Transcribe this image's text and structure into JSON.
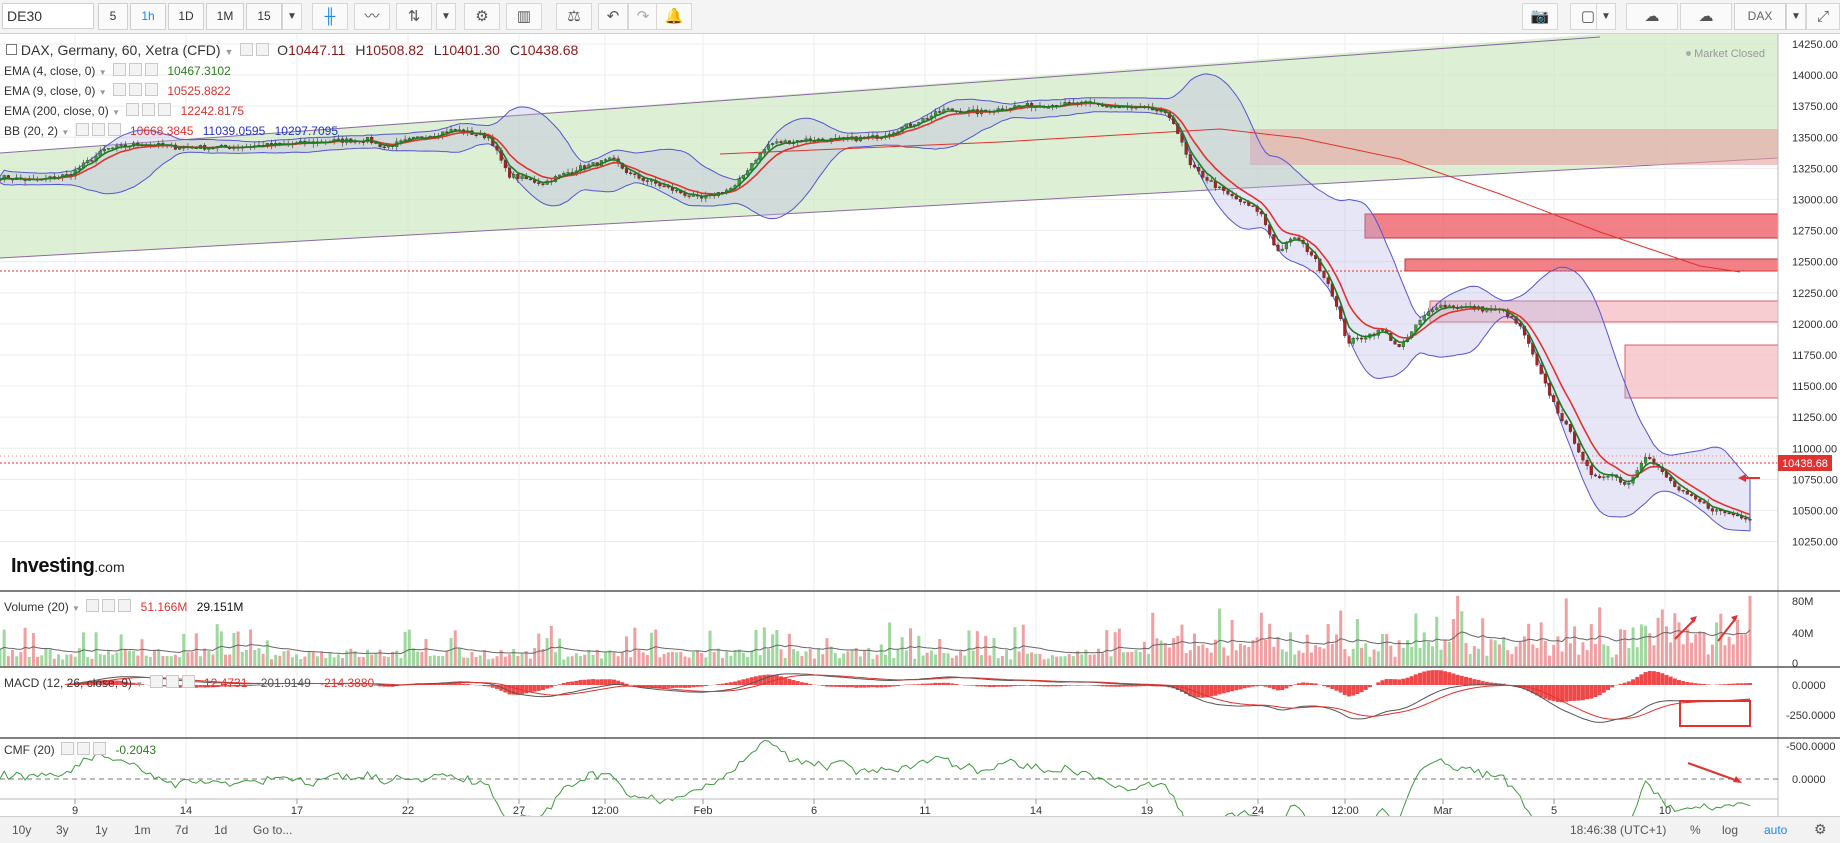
{
  "toolbar": {
    "symbol": "DE30",
    "intervals": [
      "5",
      "1h",
      "1D",
      "1M",
      "15"
    ],
    "active_interval": "1h",
    "right_label": "DAX"
  },
  "main_legend": {
    "title": "DAX, Germany, 60, Xetra (CFD)",
    "ohlc": {
      "o_label": "O",
      "o": "10447.11",
      "h_label": "H",
      "h": "10508.82",
      "l_label": "L",
      "l": "10401.30",
      "c_label": "C",
      "c": "10438.68"
    },
    "market_status": "Market Closed",
    "indicators": [
      {
        "label": "EMA (4, close, 0)",
        "value": "10467.3102",
        "color": "#2a7d1e"
      },
      {
        "label": "EMA (9, close, 0)",
        "value": "10525.8822",
        "color": "#e0322e"
      },
      {
        "label": "EMA (200, close, 0)",
        "value": "12242.8175",
        "color": "#e0322e"
      },
      {
        "label": "BB (20, 2)",
        "values": [
          "10668.3845",
          "11039.0595",
          "10297.7095"
        ],
        "colors": [
          "#e0322e",
          "#2432c8",
          "#2432c8"
        ]
      }
    ]
  },
  "price_axis": {
    "ticks": [
      "14250.00",
      "14000.00",
      "13750.00",
      "13500.00",
      "13250.00",
      "13000.00",
      "12750.00",
      "12500.00",
      "12250.00",
      "12000.00",
      "11750.00",
      "11500.00",
      "11250.00",
      "11000.00",
      "10750.00",
      "10500.00",
      "10250.00"
    ],
    "last_price": "10438.68"
  },
  "watermark": {
    "brand": "Investing",
    "suffix": ".com"
  },
  "volume_legend": {
    "label": "Volume (20)",
    "value1": "51.166M",
    "value2": "29.151M",
    "ticks": [
      "80M",
      "40M",
      "0"
    ]
  },
  "macd_legend": {
    "label": "MACD (12, 26, close, 9)",
    "values": [
      "12.4731",
      "-201.9149",
      "-214.3880"
    ],
    "ticks": [
      "0.0000",
      "-250.0000",
      "-500.0000"
    ]
  },
  "cmf_legend": {
    "label": "CMF (20)",
    "value": "-0.2043",
    "ticks": [
      "0.0000"
    ]
  },
  "time_axis": {
    "labels": [
      "9",
      "14",
      "17",
      "22",
      "27",
      "12:00",
      "Feb",
      "6",
      "11",
      "14",
      "19",
      "24",
      "12:00",
      "Mar",
      "5",
      "10"
    ]
  },
  "bottombar": {
    "ranges": [
      "10y",
      "3y",
      "1y",
      "1m",
      "7d",
      "1d"
    ],
    "goto": "Go to...",
    "clock": "18:46:38 (UTC+1)",
    "percent": "%",
    "log": "log",
    "auto": "auto"
  },
  "chart_data": {
    "type": "candlestick",
    "ylim": [
      10150,
      14330
    ],
    "close_path": [
      [
        0,
        13180
      ],
      [
        2,
        13150
      ],
      [
        4,
        13200
      ],
      [
        5,
        13300
      ],
      [
        6,
        13400
      ],
      [
        8,
        13450
      ],
      [
        10,
        13420
      ],
      [
        13,
        13420
      ],
      [
        16,
        13440
      ],
      [
        19,
        13470
      ],
      [
        21,
        13480
      ],
      [
        22,
        13420
      ],
      [
        24,
        13500
      ],
      [
        26,
        13560
      ],
      [
        28,
        13500
      ],
      [
        29,
        13200
      ],
      [
        31,
        13130
      ],
      [
        33,
        13250
      ],
      [
        35,
        13320
      ],
      [
        36,
        13200
      ],
      [
        38,
        13100
      ],
      [
        40,
        13000
      ],
      [
        42,
        13100
      ],
      [
        43,
        13300
      ],
      [
        44,
        13450
      ],
      [
        46,
        13480
      ],
      [
        48,
        13480
      ],
      [
        50,
        13500
      ],
      [
        52,
        13600
      ],
      [
        54,
        13720
      ],
      [
        56,
        13700
      ],
      [
        58,
        13750
      ],
      [
        60,
        13760
      ],
      [
        62,
        13770
      ],
      [
        64,
        13740
      ],
      [
        66,
        13720
      ],
      [
        67,
        13650
      ],
      [
        68,
        13270
      ],
      [
        70,
        13050
      ],
      [
        72,
        12900
      ],
      [
        73,
        12580
      ],
      [
        74,
        12700
      ],
      [
        75,
        12550
      ],
      [
        76,
        12300
      ],
      [
        77,
        11850
      ],
      [
        78,
        11900
      ],
      [
        79,
        11950
      ],
      [
        80,
        11800
      ],
      [
        81,
        12000
      ],
      [
        82,
        12150
      ],
      [
        84,
        12130
      ],
      [
        86,
        12100
      ],
      [
        87,
        11950
      ],
      [
        88,
        11600
      ],
      [
        89,
        11300
      ],
      [
        90,
        11050
      ],
      [
        91,
        10750
      ],
      [
        92,
        10800
      ],
      [
        93,
        10700
      ],
      [
        94,
        10950
      ],
      [
        96,
        10650
      ],
      [
        98,
        10500
      ],
      [
        100,
        10439
      ]
    ]
  }
}
